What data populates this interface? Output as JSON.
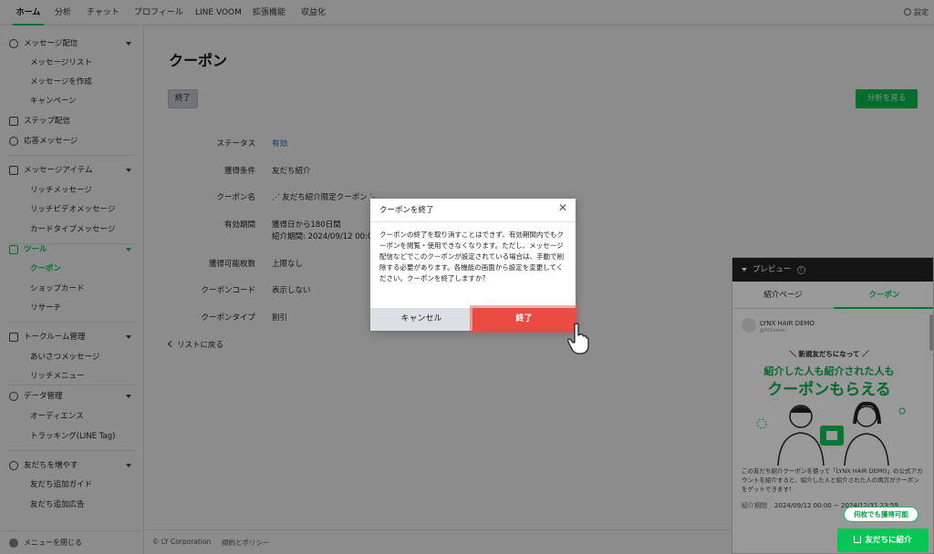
{
  "topnav": {
    "tabs": [
      "ホーム",
      "分析",
      "チャット",
      "プロフィール",
      "LINE VOOM",
      "拡張機能",
      "収益化"
    ],
    "settings": "設定"
  },
  "sidebar": {
    "message_delivery": "メッセージ配信",
    "message_list": "メッセージリスト",
    "create_message": "メッセージを作成",
    "campaign": "キャンペーン",
    "step_delivery": "ステップ配信",
    "response_message": "応答メッセージ",
    "message_items": "メッセージアイテム",
    "rich_message": "リッチメッセージ",
    "rich_video_message": "リッチビデオメッセージ",
    "card_type_message": "カードタイプメッセージ",
    "tools": "ツール",
    "coupon": "クーポン",
    "shop_card": "ショップカード",
    "research": "リサーチ",
    "talk_room_mgmt": "トークルーム管理",
    "greeting_message": "あいさつメッセージ",
    "rich_menu": "リッチメニュー",
    "data_mgmt": "データ管理",
    "audience": "オーディエンス",
    "tracking": "トラッキング(LINE Tag)",
    "increase_friends": "友だちを増やす",
    "friend_guide": "友だち追加ガイド",
    "friend_ads": "友だち追加広告",
    "close_menu": "メニューを閉じる"
  },
  "main": {
    "title": "クーポン",
    "end_button": "終了",
    "analyze_button": "分析を見る",
    "rows": {
      "status_label": "ステータス",
      "status_value": "有効",
      "condition_label": "獲得条件",
      "condition_value": "友だち紹介",
      "name_label": "クーポン名",
      "name_value": "⋰ 友だち紹介限定クーポン ⋱",
      "period_label": "有効期間",
      "period_value1": "獲得日から180日間",
      "period_value2": "紹介期間: 2024/09/12 00:00",
      "count_label": "獲得可能枚数",
      "count_value": "上限なし",
      "code_label": "クーポンコード",
      "code_value": "表示しない",
      "type_label": "クーポンタイプ",
      "type_value": "割引"
    },
    "back_link": "リストに戻る",
    "footer_copyright": "© LY Corporation",
    "footer_terms": "規約とポリシー"
  },
  "modal": {
    "title": "クーポンを終了",
    "body": "クーポンの終了を取り消すことはできず、有効期間内でもクーポンを閲覧・使用できなくなります。ただし、メッセージ配信などでこのクーポンが設定されている場合は、手動で削除する必要があります。各機能の画面から設定を変更してください。クーポンを終了しますか？",
    "cancel": "キャンセル",
    "confirm": "終了"
  },
  "preview": {
    "title": "プレビュー",
    "tab_intro": "紹介ページ",
    "tab_coupon": "クーポン",
    "account_name": "LYNX HAIR DEMO",
    "account_id": "@421vxxm",
    "banner_small": "＼ 新規友だちになって ／",
    "banner_mid": "紹介した人も紹介された人も",
    "banner_big": "クーポンもらえる",
    "description": "この友だち紹介クーポンを使って「LYNX HAIR DEMO」の公式アカウントを紹介すると、紹介した人と紹介された人の両方がクーポンをゲットできます！",
    "period_label": "紹介期間",
    "period_value": "2024/09/12 00:00 ~ 2024/12/31 23:59",
    "pill": "何枚でも獲得可能",
    "share_button": "友だちに紹介"
  },
  "colors": {
    "accent_green": "#06c755",
    "danger_red": "#eb4b43",
    "link_blue": "#1a6fc6"
  }
}
